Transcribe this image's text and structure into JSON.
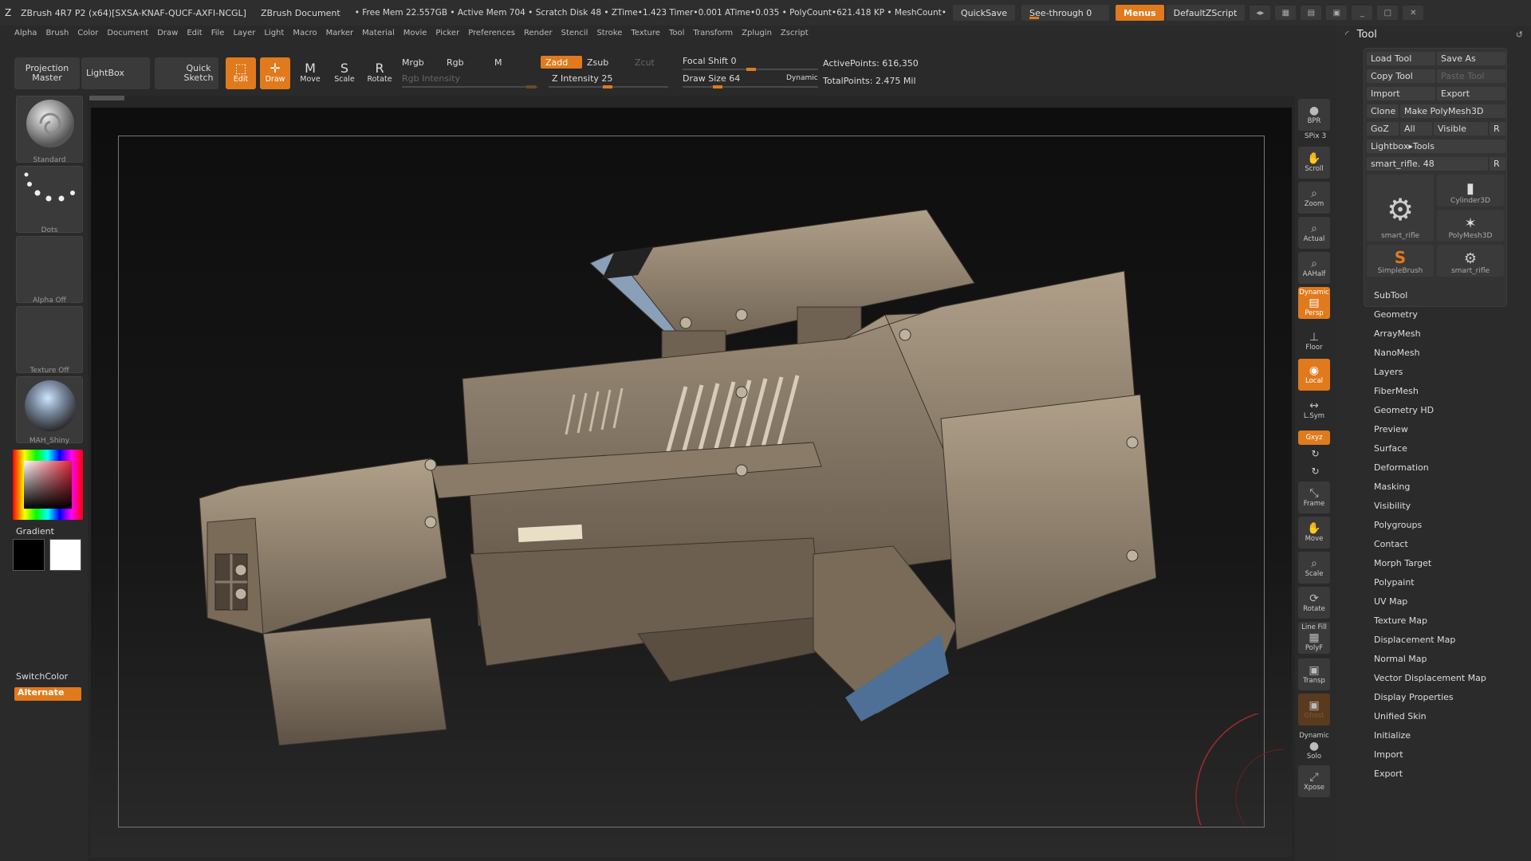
{
  "titlebar": {
    "app": "ZBrush 4R7 P2 (x64)[SXSA-KNAF-QUCF-AXFI-NCGL]",
    "doc": "ZBrush Document",
    "stats": "• Free Mem 22.557GB • Active Mem 704 • Scratch Disk 48 • ZTime•1.423 Timer•0.001 ATime•0.035 • PolyCount•621.418 KP • MeshCount•",
    "quicksave": "QuickSave",
    "seethrough": "See-through  0",
    "menus": "Menus",
    "script": "DefaultZScript"
  },
  "menubar": [
    "Alpha",
    "Brush",
    "Color",
    "Document",
    "Draw",
    "Edit",
    "File",
    "Layer",
    "Light",
    "Macro",
    "Marker",
    "Material",
    "Movie",
    "Picker",
    "Preferences",
    "Render",
    "Stencil",
    "Stroke",
    "Texture",
    "Tool",
    "Transform",
    "Zplugin",
    "Zscript"
  ],
  "toolbar": {
    "projection_master": "Projection Master",
    "lightbox": "LightBox",
    "quick_sketch": "Quick Sketch",
    "edit": "Edit",
    "draw": "Draw",
    "move": "Move",
    "scale": "Scale",
    "rotate": "Rotate",
    "mrgb": "Mrgb",
    "rgb": "Rgb",
    "m": "M",
    "rgb_intensity": "Rgb Intensity",
    "zadd": "Zadd",
    "zsub": "Zsub",
    "zcut": "Zcut",
    "z_intensity": "Z Intensity 25",
    "focal_shift": "Focal Shift 0",
    "draw_size": "Draw Size 64",
    "dynamic": "Dynamic",
    "active_points": "ActivePoints: 616,350",
    "total_points": "TotalPoints: 2.475 Mil"
  },
  "left_shelf": {
    "brush": "Standard",
    "stroke": "Dots",
    "alpha": "Alpha Off",
    "texture": "Texture Off",
    "material": "MAH_Shiny",
    "gradient": "Gradient",
    "switchcolor": "SwitchColor",
    "alternate": "Alternate"
  },
  "right_shelf": {
    "bpr": "BPR",
    "spix": "SPix 3",
    "scroll": "Scroll",
    "zoom": "Zoom",
    "actual": "Actual",
    "aahalf": "AAHalf",
    "dynamic": "Dynamic",
    "persp": "Persp",
    "floor": "Floor",
    "local": "Local",
    "lsym": "L.Sym",
    "xyz": "Gxyz",
    "frame": "Frame",
    "move": "Move",
    "scale": "Scale",
    "rotate": "Rotate",
    "line_fill": "Line Fill",
    "polyf": "PolyF",
    "transp": "Transp",
    "ghost": "Ghost",
    "dynamic2": "Dynamic",
    "solo": "Solo",
    "xpose": "Xpose"
  },
  "tool_palette": {
    "title": "Tool",
    "buttons": {
      "load_tool": "Load Tool",
      "save_as": "Save As",
      "copy_tool": "Copy Tool",
      "paste_tool": "Paste Tool",
      "import": "Import",
      "export": "Export",
      "clone": "Clone",
      "make_polymesh": "Make PolyMesh3D",
      "goz": "GoZ",
      "all": "All",
      "visible": "Visible",
      "r": "R",
      "lightbox_tools": "Lightbox▸Tools",
      "current_tool": "smart_rifle. 48",
      "r2": "R"
    },
    "thumbs": [
      "smart_rifle",
      "Cylinder3D",
      "PolyMesh3D",
      "SimpleBrush",
      "smart_rifle"
    ],
    "sections": [
      "SubTool",
      "Geometry",
      "ArrayMesh",
      "NanoMesh",
      "Layers",
      "FiberMesh",
      "Geometry HD",
      "Preview",
      "Surface",
      "Deformation",
      "Masking",
      "Visibility",
      "Polygroups",
      "Contact",
      "Morph Target",
      "Polypaint",
      "UV Map",
      "Texture Map",
      "Displacement Map",
      "Normal Map",
      "Vector Displacement Map",
      "Display Properties",
      "Unified Skin",
      "Initialize",
      "Import",
      "Export"
    ]
  }
}
